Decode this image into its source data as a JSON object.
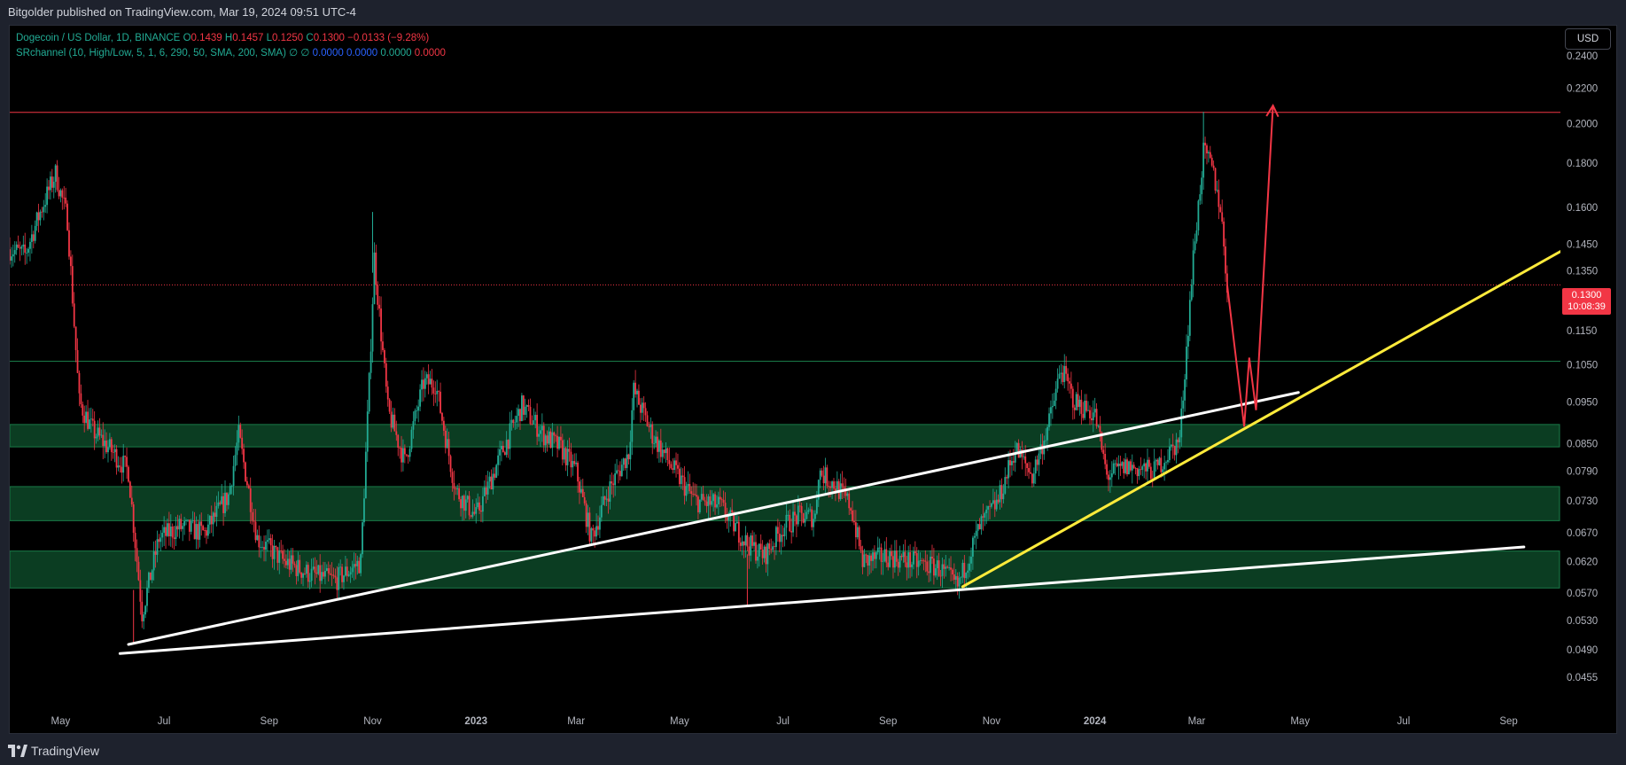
{
  "header": {
    "publish_line": "Bitgolder published on TradingView.com, Mar 19, 2024 09:51 UTC-4"
  },
  "legend": {
    "symbol": "Dogecoin / US Dollar, 1D, BINANCE",
    "o_label": "O",
    "o_value": "0.1439",
    "h_label": "H",
    "h_value": "0.1457",
    "l_label": "L",
    "l_value": "0.1250",
    "c_label": "C",
    "c_value": "0.1300",
    "change": "−0.0133 (−9.28%)",
    "indicator": "SRchannel (10, High/Low, 5, 1, 6, 290, 50, SMA, 200, SMA)",
    "indicator_symbols": "∅  ∅",
    "ind_values": [
      "0.0000",
      "0.0000",
      "0.0000",
      "0.0000"
    ]
  },
  "toolbar": {
    "currency": "USD"
  },
  "price_tag": {
    "price": "0.1300",
    "countdown": "10:08:39"
  },
  "footer": {
    "brand": "TradingView"
  },
  "colors": {
    "up": "#22ab94",
    "down": "#f23645",
    "zone": "#0b3d22",
    "zone_border": "#1a7a48",
    "trend_white": "#ffffff",
    "trend_yellow": "#ffeb3b",
    "arrow": "#f23645",
    "ind_blue": "#2962ff"
  },
  "chart_data": {
    "type": "candlestick",
    "scale": "log",
    "ylim": [
      0.042,
      0.26
    ],
    "y_ticks": [
      "0.2400",
      "0.2200",
      "0.2000",
      "0.1800",
      "0.1600",
      "0.1450",
      "0.1350",
      "0.1150",
      "0.1050",
      "0.0950",
      "0.0850",
      "0.0790",
      "0.0730",
      "0.0670",
      "0.0620",
      "0.0570",
      "0.0530",
      "0.0490",
      "0.0455"
    ],
    "x_labels": [
      {
        "label": "May",
        "date": "2022-05-01"
      },
      {
        "label": "Jul",
        "date": "2022-07-01"
      },
      {
        "label": "Sep",
        "date": "2022-09-01"
      },
      {
        "label": "Nov",
        "date": "2022-11-01"
      },
      {
        "label": "2023",
        "date": "2023-01-01"
      },
      {
        "label": "Mar",
        "date": "2023-03-01"
      },
      {
        "label": "May",
        "date": "2023-05-01"
      },
      {
        "label": "Jul",
        "date": "2023-07-01"
      },
      {
        "label": "Sep",
        "date": "2023-09-01"
      },
      {
        "label": "Nov",
        "date": "2023-11-01"
      },
      {
        "label": "2024",
        "date": "2024-01-01"
      },
      {
        "label": "Mar",
        "date": "2024-03-01"
      },
      {
        "label": "May",
        "date": "2024-05-01"
      },
      {
        "label": "Jul",
        "date": "2024-07-01"
      },
      {
        "label": "Sep",
        "date": "2024-09-01"
      }
    ],
    "x_range": [
      "2022-04-01",
      "2024-10-01"
    ],
    "price_path": [
      [
        "2022-04-01",
        0.143
      ],
      [
        "2022-04-10",
        0.141
      ],
      [
        "2022-04-20",
        0.16
      ],
      [
        "2022-04-28",
        0.175
      ],
      [
        "2022-05-05",
        0.155
      ],
      [
        "2022-05-12",
        0.095
      ],
      [
        "2022-05-20",
        0.088
      ],
      [
        "2022-06-01",
        0.083
      ],
      [
        "2022-06-10",
        0.079
      ],
      [
        "2022-06-18",
        0.054
      ],
      [
        "2022-06-28",
        0.066
      ],
      [
        "2022-07-10",
        0.068
      ],
      [
        "2022-07-25",
        0.067
      ],
      [
        "2022-08-08",
        0.074
      ],
      [
        "2022-08-14",
        0.087
      ],
      [
        "2022-08-25",
        0.066
      ],
      [
        "2022-09-10",
        0.062
      ],
      [
        "2022-09-25",
        0.06
      ],
      [
        "2022-10-10",
        0.059
      ],
      [
        "2022-10-25",
        0.062
      ],
      [
        "2022-10-30",
        0.1
      ],
      [
        "2022-11-02",
        0.14
      ],
      [
        "2022-11-10",
        0.093
      ],
      [
        "2022-11-20",
        0.081
      ],
      [
        "2022-12-01",
        0.1
      ],
      [
        "2022-12-08",
        0.1
      ],
      [
        "2022-12-20",
        0.075
      ],
      [
        "2023-01-01",
        0.07
      ],
      [
        "2023-01-15",
        0.082
      ],
      [
        "2023-01-28",
        0.094
      ],
      [
        "2023-02-10",
        0.087
      ],
      [
        "2023-02-20",
        0.084
      ],
      [
        "2023-03-01",
        0.079
      ],
      [
        "2023-03-10",
        0.066
      ],
      [
        "2023-03-20",
        0.075
      ],
      [
        "2023-04-01",
        0.083
      ],
      [
        "2023-04-04",
        0.098
      ],
      [
        "2023-04-15",
        0.087
      ],
      [
        "2023-04-28",
        0.079
      ],
      [
        "2023-05-10",
        0.073
      ],
      [
        "2023-05-25",
        0.072
      ],
      [
        "2023-06-10",
        0.065
      ],
      [
        "2023-06-20",
        0.063
      ],
      [
        "2023-07-01",
        0.068
      ],
      [
        "2023-07-10",
        0.07
      ],
      [
        "2023-07-20",
        0.07
      ],
      [
        "2023-07-22",
        0.079
      ],
      [
        "2023-08-01",
        0.076
      ],
      [
        "2023-08-10",
        0.072
      ],
      [
        "2023-08-17",
        0.062
      ],
      [
        "2023-09-01",
        0.063
      ],
      [
        "2023-09-15",
        0.062
      ],
      [
        "2023-10-01",
        0.061
      ],
      [
        "2023-10-12",
        0.058
      ],
      [
        "2023-10-25",
        0.068
      ],
      [
        "2023-11-05",
        0.073
      ],
      [
        "2023-11-15",
        0.084
      ],
      [
        "2023-11-25",
        0.078
      ],
      [
        "2023-12-05",
        0.09
      ],
      [
        "2023-12-12",
        0.104
      ],
      [
        "2023-12-20",
        0.095
      ],
      [
        "2024-01-01",
        0.092
      ],
      [
        "2024-01-08",
        0.078
      ],
      [
        "2024-01-20",
        0.08
      ],
      [
        "2024-02-05",
        0.079
      ],
      [
        "2024-02-20",
        0.086
      ],
      [
        "2024-02-28",
        0.14
      ],
      [
        "2024-03-05",
        0.185
      ],
      [
        "2024-03-10",
        0.178
      ],
      [
        "2024-03-15",
        0.16
      ],
      [
        "2024-03-19",
        0.13
      ]
    ],
    "wick_extremes": [
      {
        "date": "2024-03-05",
        "high": 0.2065
      },
      {
        "date": "2022-06-13",
        "low": 0.05
      },
      {
        "date": "2023-06-10",
        "low": 0.055
      },
      {
        "date": "2022-11-01",
        "high": 0.158
      }
    ],
    "support_zones": [
      [
        0.0843,
        0.0895
      ],
      [
        0.0692,
        0.0758
      ],
      [
        0.0578,
        0.0638
      ]
    ],
    "levels": [
      {
        "price": 0.2062,
        "style": "solid",
        "color": "#f23645"
      },
      {
        "price": 0.13,
        "style": "dotted",
        "color": "#f23645"
      },
      {
        "price": 0.106,
        "style": "solid",
        "color": "#1a7a48"
      }
    ],
    "trendlines": [
      {
        "color": "#ffffff",
        "from": [
          "2022-06-10",
          0.0497
        ],
        "to": [
          "2024-04-30",
          0.0975
        ]
      },
      {
        "color": "#ffffff",
        "from": [
          "2022-06-05",
          0.0485
        ],
        "to": [
          "2024-09-10",
          0.0645
        ]
      },
      {
        "color": "#ffeb3b",
        "from": [
          "2023-10-15",
          0.058
        ],
        "to": [
          "2024-10-20",
          0.149
        ]
      }
    ],
    "projection": [
      [
        "2024-03-19",
        0.13
      ],
      [
        "2024-03-29",
        0.089
      ],
      [
        "2024-04-01",
        0.107
      ],
      [
        "2024-04-05",
        0.093
      ],
      [
        "2024-04-15",
        0.21
      ]
    ]
  }
}
